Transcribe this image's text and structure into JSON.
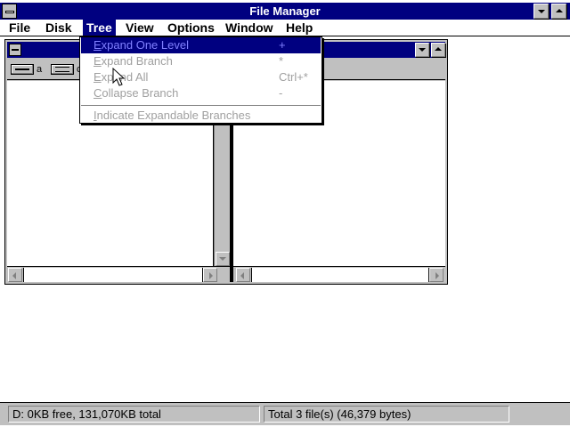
{
  "app": {
    "title": "File Manager"
  },
  "menubar": {
    "items": [
      {
        "label": "File"
      },
      {
        "label": "Disk"
      },
      {
        "label": "Tree"
      },
      {
        "label": "View"
      },
      {
        "label": "Options"
      },
      {
        "label": "Window"
      },
      {
        "label": "Help"
      }
    ],
    "active": "Tree"
  },
  "tree_menu": {
    "items": [
      {
        "label": "Expand One Level",
        "shortcut": "+",
        "state": "highlighted, grayed"
      },
      {
        "label": "Expand Branch",
        "shortcut": "*",
        "state": "grayed"
      },
      {
        "label": "Expand All",
        "shortcut": "Ctrl+*",
        "state": "grayed"
      },
      {
        "label": "Collapse Branch",
        "shortcut": "-",
        "state": "grayed"
      },
      {
        "label": "Indicate Expandable Branches",
        "shortcut": "",
        "state": "grayed"
      }
    ]
  },
  "drives": [
    {
      "letter": "a",
      "icon": "floppy-drive-icon"
    },
    {
      "letter": "c",
      "icon": "hard-drive-icon"
    }
  ],
  "status": {
    "left": "D: 0KB free,  131,070KB total",
    "right": "Total 3 file(s) (46,379 bytes)"
  },
  "colors": {
    "titlebar": "#000080",
    "face": "#c0c0c0",
    "window": "#ffffff",
    "disabled_text": "#a0a0a0"
  }
}
